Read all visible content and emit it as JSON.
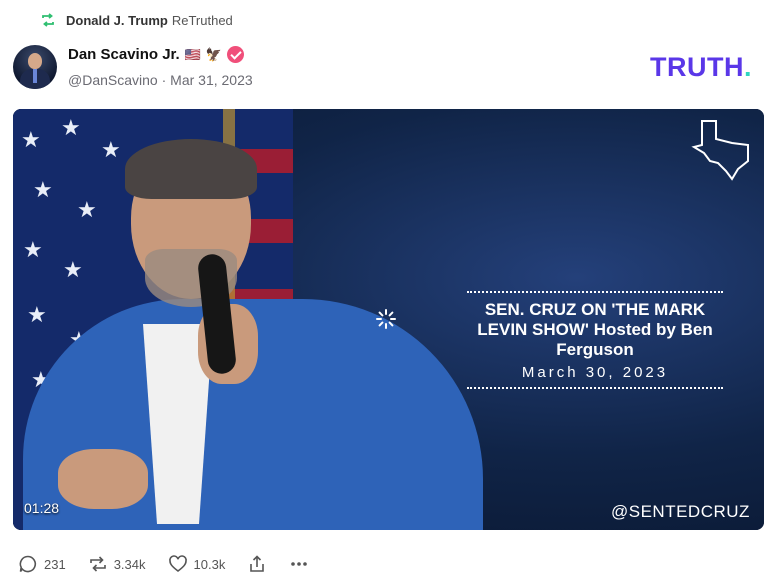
{
  "retruth": {
    "icon": "retruth-icon",
    "user": "Donald J. Trump",
    "action": "ReTruthed",
    "accent": "#2fbf71"
  },
  "author": {
    "name": "Dan Scavino Jr.",
    "flag": "🇺🇸",
    "eagle": "🦅",
    "verified_color": "#f04f7a",
    "handle": "@DanScavino",
    "separator": "·",
    "date": "Mar 31, 2023"
  },
  "brand": {
    "logo": "TRUTH",
    "logo_dot": ".",
    "color": "#5a37e8",
    "dot_color": "#2fd6c0"
  },
  "video": {
    "caption_title": "SEN. CRUZ ON 'THE MARK LEVIN SHOW' Hosted by Ben Ferguson",
    "caption_date": "March 30, 2023",
    "duration": "01:28",
    "handle": "@SENTEDCRUZ",
    "state_icon": "texas-outline-icon",
    "loading_icon": "spinner-icon"
  },
  "actions": {
    "replies": {
      "icon": "reply-icon",
      "count": "231"
    },
    "retruths": {
      "icon": "retruth-icon",
      "count": "3.34k"
    },
    "likes": {
      "icon": "heart-icon",
      "count": "10.3k"
    },
    "share": {
      "icon": "share-icon"
    },
    "more": {
      "icon": "more-icon"
    }
  }
}
